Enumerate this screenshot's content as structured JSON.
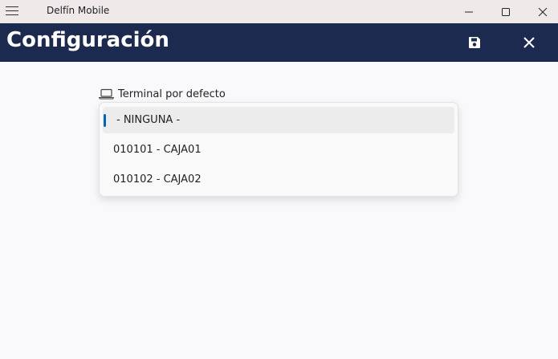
{
  "window": {
    "app_title": "Delfín Mobile"
  },
  "header": {
    "title": "Configuración",
    "background_color": "#1d2a4f"
  },
  "field": {
    "label": "Terminal por defecto",
    "icon": "laptop-icon"
  },
  "dropdown": {
    "options": [
      {
        "label": "- NINGUNA -",
        "selected": true
      },
      {
        "label": "010101 - CAJA01",
        "selected": false
      },
      {
        "label": "010102 - CAJA02",
        "selected": false
      }
    ],
    "accent_color": "#0067c0"
  }
}
